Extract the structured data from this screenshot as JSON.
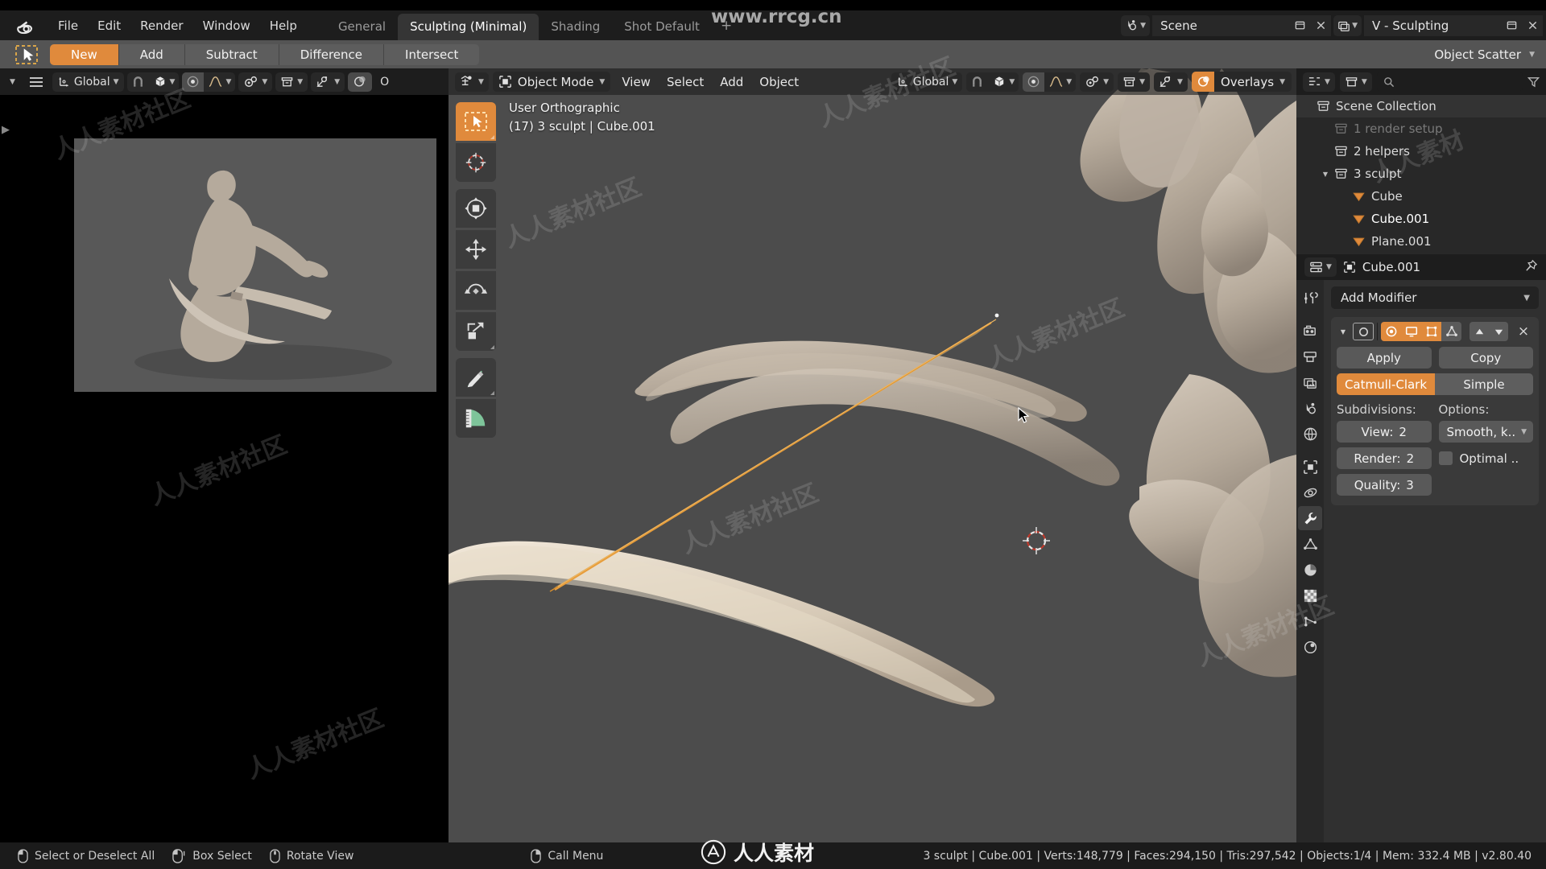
{
  "app": {
    "logo_icon": "blender-logo-icon",
    "watermark_top": "www.rrcg.cn",
    "watermark_bottom": "人人素材"
  },
  "menubar": {
    "items": [
      "File",
      "Edit",
      "Render",
      "Window",
      "Help"
    ],
    "workspace_tabs": [
      {
        "label": "General",
        "active": false
      },
      {
        "label": "Sculpting (Minimal)",
        "active": true
      },
      {
        "label": "Shading",
        "active": false
      },
      {
        "label": "Shot Default",
        "active": false
      }
    ],
    "add_tab_label": "+",
    "scene_icon": "scene-icon",
    "scene_name": "Scene",
    "viewlayer_icon": "view-layer-icon",
    "viewlayer_name": "V - Sculpting",
    "new_scene_icon": "new-scene-icon",
    "remove_scene_icon": "close-icon",
    "new_viewlayer_icon": "new-viewlayer-icon",
    "remove_viewlayer_icon": "close-icon"
  },
  "booltoolbar": {
    "select_icon": "tweak-select-icon",
    "buttons": [
      {
        "label": "New",
        "active": true
      },
      {
        "label": "Add",
        "active": false
      },
      {
        "label": "Subtract",
        "active": false
      },
      {
        "label": "Difference",
        "active": false
      },
      {
        "label": "Intersect",
        "active": false
      }
    ],
    "addon_selector": "Object Scatter"
  },
  "toolsettings_header": {
    "editor_type_icon": "editor-type-icon",
    "menu_icon": "hamburger-icon",
    "orientation_icon": "orientation-axis-icon",
    "orientation": "Global",
    "snap_magnet_icon": "magnet-icon",
    "snap_target_icon": "snap-cube-icon",
    "proportional_icon": "proportional-edit-icon",
    "falloff_icon": "smooth-falloff-icon",
    "pivot_icon": "pivot-point-icon",
    "collection_icon": "collection-visibility-icon",
    "gizmo_icon": "gizmo-icon",
    "overlays_icon": "overlays-icon",
    "overlays_partial_label": "O"
  },
  "viewport": {
    "header": {
      "editor_type_icon": "3d-viewport-icon",
      "mode_icon": "object-mode-icon",
      "mode": "Object Mode",
      "menus": [
        "View",
        "Select",
        "Add",
        "Object"
      ],
      "orientation_icon": "orientation-axis-icon",
      "orientation": "Global",
      "snap_magnet_icon": "magnet-icon",
      "snap_target_icon": "snap-cube-icon",
      "proportional_icon": "proportional-edit-icon",
      "falloff_icon": "smooth-falloff-icon",
      "pivot_icon": "pivot-point-icon",
      "overlays_toggle_icon": "overlays-icon",
      "overlays_label": "Overlays"
    },
    "overlay_text_line1": "User Orthographic",
    "overlay_text_line2": "(17) 3 sculpt | Cube.001",
    "toolbar": [
      {
        "name": "tweak-select-tool",
        "icon": "tweak-select-icon",
        "active": true
      },
      {
        "name": "cursor-tool",
        "icon": "3d-cursor-icon",
        "active": false
      },
      {
        "name": "move-rotate-scale-tool",
        "icon": "transform-icon",
        "active": false
      },
      {
        "name": "move-tool",
        "icon": "move-icon",
        "active": false
      },
      {
        "name": "rotate-tool",
        "icon": "rotate-icon",
        "active": false
      },
      {
        "name": "scale-tool",
        "icon": "scale-icon",
        "active": false
      },
      {
        "name": "annotate-tool",
        "icon": "annotate-pencil-icon",
        "active": false
      },
      {
        "name": "measure-tool",
        "icon": "measure-ruler-icon",
        "active": false
      }
    ],
    "background_color": "#4c4c4c",
    "mesh_color": "#b9ada0",
    "selected_outline_color": "#e6a23c"
  },
  "preview": {
    "label": "sculpt-reference-preview",
    "background": "#4f4f4f"
  },
  "outliner": {
    "header": {
      "editor_type_icon": "outliner-icon",
      "display_mode_icon": "display-mode-icon",
      "filter_icon": "filter-icon",
      "search_icon": "search-icon",
      "search_placeholder": ""
    },
    "rows": [
      {
        "label": "Scene Collection",
        "depth": 0,
        "icon": "collection-icon",
        "state": "header",
        "expandable": false
      },
      {
        "label": "1 render setup",
        "depth": 1,
        "icon": "collection-icon",
        "state": "dim",
        "expandable": false
      },
      {
        "label": "2 helpers",
        "depth": 1,
        "icon": "collection-icon",
        "state": "normal",
        "expandable": false
      },
      {
        "label": "3 sculpt",
        "depth": 1,
        "icon": "collection-icon",
        "state": "normal",
        "expandable": true,
        "expanded": true
      },
      {
        "label": "Cube",
        "depth": 2,
        "icon": "mesh-object-icon",
        "state": "normal",
        "expandable": false
      },
      {
        "label": "Cube.001",
        "depth": 2,
        "icon": "mesh-object-icon",
        "state": "selected",
        "expandable": false
      },
      {
        "label": "Plane.001",
        "depth": 2,
        "icon": "mesh-object-icon",
        "state": "normal",
        "expandable": false
      }
    ]
  },
  "properties": {
    "header": {
      "editor_type_icon": "properties-icon",
      "object_icon": "object-data-icon",
      "object_name": "Cube.001",
      "pin_icon": "pin-icon"
    },
    "tabs": [
      {
        "name": "tool",
        "icon": "tool-wrench-screwdriver-icon",
        "active": false
      },
      {
        "name": "render",
        "icon": "render-camera-icon",
        "active": false,
        "sep": true
      },
      {
        "name": "output",
        "icon": "output-printer-icon",
        "active": false
      },
      {
        "name": "view-layer",
        "icon": "view-layer-images-icon",
        "active": false
      },
      {
        "name": "scene",
        "icon": "scene-cone-icon",
        "active": false
      },
      {
        "name": "world",
        "icon": "world-globe-icon",
        "active": false
      },
      {
        "name": "object",
        "icon": "object-square-icon",
        "active": false,
        "sep": true
      },
      {
        "name": "modifiers-physics",
        "icon": "physics-orbit-icon",
        "active": false
      },
      {
        "name": "modifiers",
        "icon": "wrench-icon",
        "active": true
      },
      {
        "name": "particles",
        "icon": "particles-icon",
        "active": false
      },
      {
        "name": "physics",
        "icon": "physics-pie-icon",
        "active": false
      },
      {
        "name": "object-constraints",
        "icon": "checker-texture-icon",
        "active": false
      },
      {
        "name": "object-data",
        "icon": "data-vertex-icon",
        "active": false
      },
      {
        "name": "material",
        "icon": "material-sphere-icon",
        "active": false
      }
    ],
    "add_modifier_label": "Add Modifier",
    "modifier": {
      "expand_icon": "triangle-down-icon",
      "type_icon": "subsurf-icon",
      "name": "",
      "toggles": [
        {
          "name": "on-cage",
          "icon": "editmode-cage-icon",
          "on": true
        },
        {
          "name": "realtime-display",
          "icon": "monitor-icon",
          "on": true
        },
        {
          "name": "edit-mode-display",
          "icon": "editmode-icon",
          "on": true
        },
        {
          "name": "show-in-editmode-vertices",
          "icon": "vertex-triangle-icon",
          "on": false
        }
      ],
      "move_up_icon": "arrow-up-icon",
      "move_down_icon": "arrow-down-icon",
      "delete_icon": "x-icon",
      "apply_label": "Apply",
      "copy_label": "Copy",
      "subdivision_type": [
        {
          "label": "Catmull-Clark",
          "active": true
        },
        {
          "label": "Simple",
          "active": false
        }
      ],
      "subdivisions_label": "Subdivisions:",
      "options_label": "Options:",
      "view_label": "View:",
      "view_value": "2",
      "render_label": "Render:",
      "render_value": "2",
      "quality_label": "Quality:",
      "quality_value": "3",
      "uv_smooth_value": "Smooth, k..",
      "optimal_display_label": "Optimal ..",
      "optimal_display_checked": false
    }
  },
  "statusbar": {
    "keymap": [
      {
        "icon": "mouse-left-icon",
        "label": "Select or Deselect All"
      },
      {
        "icon": "mouse-left-drag-icon",
        "label": "Box Select"
      },
      {
        "icon": "mouse-middle-icon",
        "label": "Rotate View"
      },
      {
        "icon": "mouse-right-icon",
        "label": "Call Menu"
      }
    ],
    "stats": "3 sculpt | Cube.001 | Verts:148,779 | Faces:294,150 | Tris:297,542 | Objects:1/4 | Mem: 332.4 MB | v2.80.40"
  }
}
